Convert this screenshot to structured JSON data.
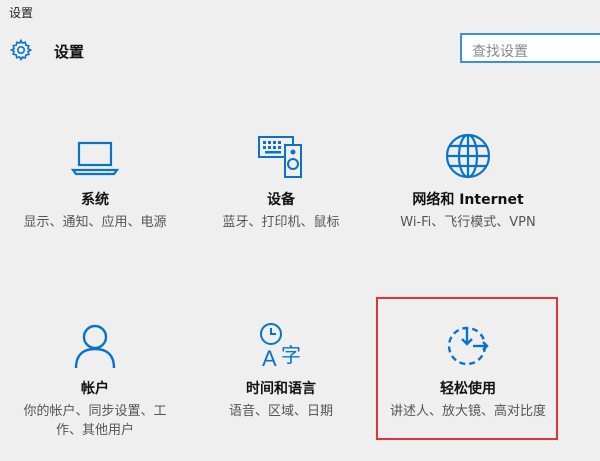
{
  "window": {
    "title": "设置"
  },
  "header": {
    "title": "设置",
    "icon": "gear-icon"
  },
  "search": {
    "placeholder": "查找设置"
  },
  "accent_color": "#0a73c9",
  "highlight_color": "#e03434",
  "tiles": [
    {
      "name": "系统",
      "desc": "显示、通知、应用、电源",
      "icon": "laptop-icon"
    },
    {
      "name": "设备",
      "desc": "蓝牙、打印机、鼠标",
      "icon": "devices-icon"
    },
    {
      "name": "网络和 Internet",
      "desc": "Wi-Fi、飞行模式、VPN",
      "icon": "globe-icon"
    },
    {
      "name": "帐户",
      "desc": "你的帐户、同步设置、工作、其他用户",
      "icon": "person-icon"
    },
    {
      "name": "时间和语言",
      "desc": "语音、区域、日期",
      "icon": "time-language-icon"
    },
    {
      "name": "轻松使用",
      "desc": "讲述人、放大镜、高对比度",
      "icon": "ease-of-access-icon",
      "highlighted": true
    }
  ]
}
